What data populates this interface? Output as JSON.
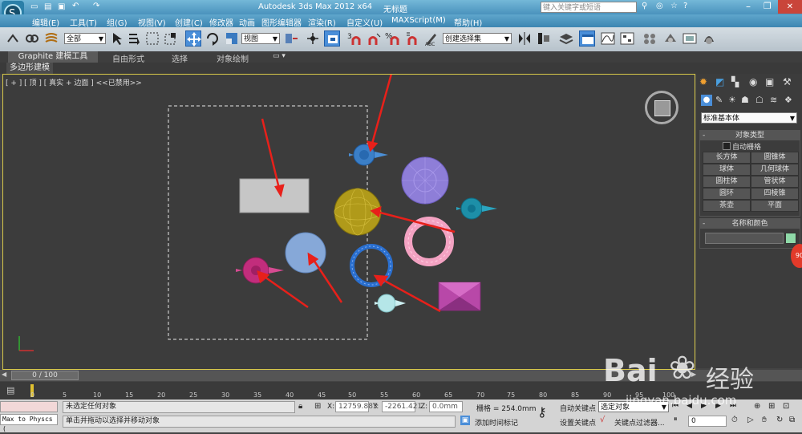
{
  "app": {
    "title": "Autodesk 3ds Max  2012 x64",
    "doc_title": "无标题",
    "search_placeholder": "键入关键字或短语"
  },
  "menu": [
    "编辑(E)",
    "工具(T)",
    "组(G)",
    "视图(V)",
    "创建(C)",
    "修改器",
    "动画",
    "图形编辑器",
    "渲染(R)",
    "自定义(U)",
    "MAXScript(M)",
    "帮助(H)"
  ],
  "toolbar": {
    "selection_filter": "全部",
    "ref_coord": "视图",
    "named_selection": "创建选择集",
    "snap_number": "3",
    "snap_percent": "%"
  },
  "ribbon": {
    "tabs": [
      "Graphite 建模工具",
      "自由形式",
      "选择",
      "对象绘制"
    ],
    "sub_label": "多边形建模"
  },
  "viewport": {
    "label": "[ + ] [ 顶 ] [ 真实 + 边面 ] <<已禁用>>"
  },
  "right_panel": {
    "category": "标准基本体",
    "rollout_object_type": "对象类型",
    "auto_grid": "自动栅格",
    "buttons": [
      "长方体",
      "圆锥体",
      "球体",
      "几何球体",
      "圆柱体",
      "管状体",
      "圆环",
      "四棱锥",
      "茶壶",
      "平面"
    ],
    "rollout_name_color": "名称和颜色",
    "color": "#8fd9a8"
  },
  "timeline": {
    "position": "0 / 100",
    "ticks": [
      "0",
      "5",
      "10",
      "15",
      "20",
      "25",
      "30",
      "35",
      "40",
      "45",
      "50",
      "55",
      "60",
      "65",
      "70",
      "75",
      "80",
      "85",
      "90",
      "95",
      "100"
    ]
  },
  "status": {
    "script_listener": "Max to Physcs (",
    "selection_status": "未选定任何对象",
    "prompt": "单击并拖动以选择并移动对象",
    "x_label": "X:",
    "x_value": "12759.883",
    "y_label": "Y:",
    "y_value": "-2261.421",
    "z_label": "Z:",
    "z_value": "0.0mm",
    "grid": "栅格 = 254.0mm",
    "add_time_tag": "添加时间标记",
    "auto_key": "自动关键点",
    "set_key": "设置关键点",
    "selected_object": "选定对象",
    "key_filters": "关键点过滤器...",
    "frame": "0"
  },
  "watermark": {
    "brand": "Bai",
    "brand2": "经验",
    "url": "jingyan.baidu.com"
  },
  "badge": "90"
}
